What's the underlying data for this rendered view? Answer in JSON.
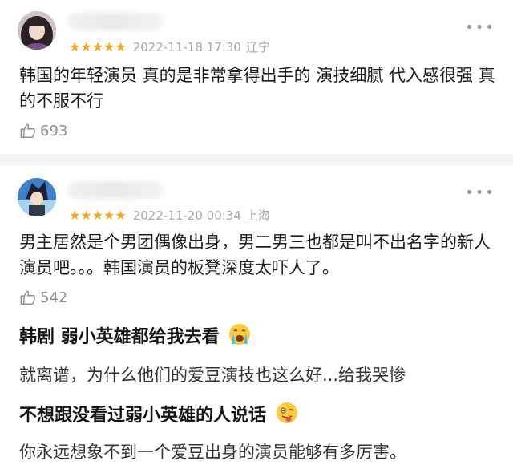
{
  "comments": [
    {
      "stars": "★★★★★",
      "date": "2022-11-18 17:30",
      "location": "辽宁",
      "text": "韩国的年轻演员 真的是非常拿得出手的 演技细腻 代入感很强 真的不服不行",
      "likes": "693",
      "more_icon": "•••"
    },
    {
      "stars": "★★★★★",
      "date": "2022-11-20 00:34",
      "location": "上海",
      "text": "男主居然是个男团偶像出身，男二男三也都是叫不出名字的新人演员吧。。。韩国演员的板凳深度太吓人了。",
      "likes": "542",
      "more_icon": "•••"
    }
  ],
  "posts": {
    "line1": "韩剧 弱小英雄都给我去看",
    "line2": "就离谱，为什么他们的爱豆演技也这么好...给我哭惨",
    "line3": "不想跟没看过弱小英雄的人说话",
    "line4": "你永远想象不到一个爱豆出身的演员能够有多厉害。"
  },
  "colors": {
    "star": "#f6a623",
    "meta": "#a6a6a6",
    "divider": "#f4f4f4"
  },
  "icons": [
    "thumbs-up-icon",
    "more-icon",
    "crying-face-icon",
    "winking-tongue-face-icon"
  ]
}
